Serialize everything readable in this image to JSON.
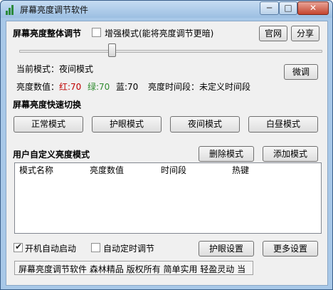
{
  "window": {
    "title": "屏幕亮度调节软件"
  },
  "titlebar": {
    "minimize_glyph": "─",
    "maximize_glyph": "□",
    "close_glyph": "✕"
  },
  "brightness": {
    "section_title": "屏幕亮度整体调节",
    "enhance_label": "增强模式(能将亮度调节更暗)",
    "enhance_checked": false,
    "official_site_button": "官网",
    "share_button": "分享",
    "slider_level": 0.3
  },
  "current_mode": {
    "label": "当前模式：夜间模式",
    "fine_tune_button": "微调"
  },
  "values": {
    "prefix": "亮度数值：",
    "red": "红:70",
    "green": "绿:70",
    "blue": "蓝:70",
    "time_period": "亮度时间段：未定义时间段",
    "red_color": "#c00000",
    "green_color": "#2e8b2e"
  },
  "quick_switch": {
    "title": "屏幕亮度快速切换",
    "modes": [
      "正常模式",
      "护眼模式",
      "夜间模式",
      "白昼模式"
    ]
  },
  "custom_modes": {
    "title": "用户自定义亮度模式",
    "delete_button": "删除模式",
    "add_button": "添加模式",
    "columns": [
      "模式名称",
      "亮度数值",
      "时间段",
      "热键"
    ]
  },
  "options": {
    "autostart_label": "开机自动启动",
    "autostart_checked": true,
    "timed_label": "自动定时调节",
    "timed_checked": false,
    "eye_settings_button": "护眼设置",
    "more_settings_button": "更多设置"
  },
  "statusbar": {
    "text": "屏幕亮度调节软件 森林精品 版权所有 简单实用 轻盈灵动 当"
  }
}
